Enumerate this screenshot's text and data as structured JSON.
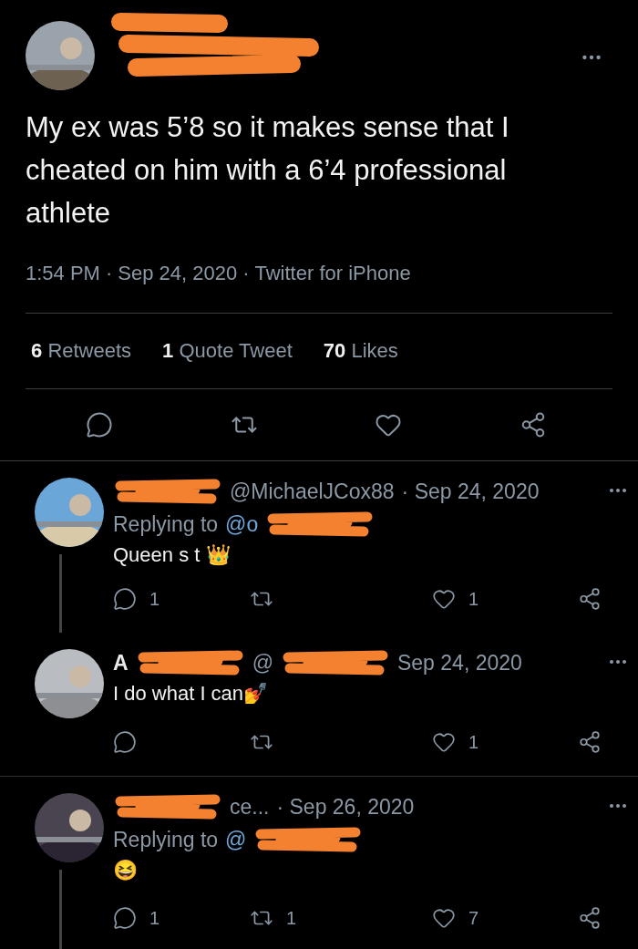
{
  "tweet": {
    "text": "My ex was 5’8 so it makes sense that I cheated on him with a 6’4 professional athlete",
    "meta": [
      "1:54 PM",
      "·",
      "Sep 24, 2020",
      "·",
      "Twitter for iPhone"
    ],
    "stats": [
      {
        "count": "6",
        "label": "Retweets"
      },
      {
        "count": "1",
        "label": "Quote Tweet"
      },
      {
        "count": "70",
        "label": "Likes"
      }
    ]
  },
  "replies": [
    {
      "header": [
        {
          "kind": "redaction"
        },
        {
          "kind": "handle",
          "text": "@MichaelJCox88"
        },
        {
          "kind": "date",
          "text": "· Sep 24, 2020"
        }
      ],
      "replying": [
        {
          "kind": "label",
          "text": "Replying to"
        },
        {
          "kind": "mention",
          "text": "@o"
        },
        {
          "kind": "redaction"
        }
      ],
      "text": "Queen s  t 👑",
      "reply_count": "1",
      "like_count": "1",
      "thread_line": true
    },
    {
      "header": [
        {
          "kind": "name",
          "text": "A"
        },
        {
          "kind": "redaction"
        },
        {
          "kind": "handle",
          "text": "@"
        },
        {
          "kind": "redaction"
        },
        {
          "kind": "date",
          "text": "Sep 24, 2020"
        }
      ],
      "text": "I do what I can💅",
      "like_count": "1",
      "thread_line": false
    },
    {
      "header": [
        {
          "kind": "redaction"
        },
        {
          "kind": "handle",
          "text": "ce..."
        },
        {
          "kind": "date",
          "text": "· Sep 26, 2020"
        }
      ],
      "replying": [
        {
          "kind": "label",
          "text": "Replying to"
        },
        {
          "kind": "mention",
          "text": "@"
        },
        {
          "kind": "redaction"
        }
      ],
      "text": "😆",
      "reply_count": "1",
      "retweet_count": "1",
      "like_count": "7",
      "thread_line": true
    }
  ]
}
